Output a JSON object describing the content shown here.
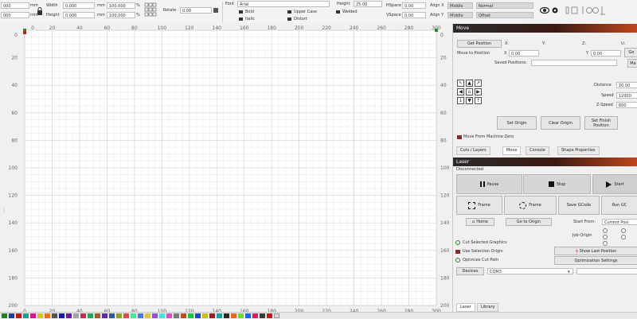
{
  "toolbar": {
    "x_value": "000",
    "y_value": "000",
    "width_label": "Width",
    "width_value": "0.000",
    "height_label": "Height",
    "height_value": "0.000",
    "unit_mm": "mm",
    "scale_w": "100.000",
    "scale_h": "100.000",
    "pct": "%",
    "rotate_label": "Rotate",
    "rotate_value": "0.00",
    "font_label": "Font",
    "font_value": "Arial",
    "font_height_label": "Height",
    "font_height_value": "25.00",
    "bold": "Bold",
    "italic": "Italic",
    "upper_case": "Upper Case",
    "distort": "Distort",
    "welded": "Welded",
    "hspace_label": "HSpace",
    "hspace_value": "0.00",
    "vspace_label": "VSpace",
    "vspace_value": "0.00",
    "align_x_label": "Align X",
    "align_x_value": "Middle",
    "align_y_label": "Align Y",
    "align_y_value": "Middle",
    "normal_value": "Normal",
    "offset_value": "Offset"
  },
  "ruler": {
    "top_ticks": [
      "0",
      "20",
      "40",
      "60",
      "80",
      "100",
      "120",
      "140",
      "160",
      "180",
      "200",
      "220",
      "240",
      "260",
      "280",
      "300"
    ],
    "left_ticks": [
      "0",
      "20",
      "40",
      "60",
      "80",
      "100",
      "120",
      "140",
      "160",
      "180",
      "200"
    ],
    "right_ticks": [
      "0",
      "20",
      "40",
      "60",
      "80",
      "100",
      "120",
      "140",
      "160",
      "180",
      "200"
    ],
    "bottom_ticks": [
      "0",
      "20",
      "40",
      "60",
      "80",
      "100",
      "120",
      "140",
      "160",
      "180",
      "200",
      "220",
      "240",
      "260",
      "280",
      "300"
    ]
  },
  "move": {
    "header": "Move",
    "get_position": "Get Position",
    "x_label": "X:",
    "y_label": "Y:",
    "z_label": "Z:",
    "u_label": "U:",
    "move_to_position": "Move to Position",
    "x_short": "X",
    "x_value": "0.00",
    "y_short": "Y",
    "y_value": "0.00",
    "go_label": "Go",
    "saved_positions": "Saved Positions:",
    "manage_label": "Ma",
    "distance_label": "Distance",
    "distance_value": "20.00",
    "speed_label": "Speed",
    "speed_value": "12000",
    "zspeed_label": "Z-Speed",
    "zspeed_value": "600",
    "set_origin": "Set Origin",
    "clear_origin": "Clear Origin",
    "set_finish": "Set Finish Position",
    "move_from_zero": "Move From Machine Zero"
  },
  "tabs_mid": [
    "Cuts / Layers",
    "Move",
    "Console",
    "Shape Properties"
  ],
  "laser": {
    "header": "Laser",
    "status": "Disconnected",
    "pause": "Pause",
    "stop": "Stop",
    "start": "Start",
    "frame1": "Frame",
    "frame2": "Frame",
    "save_gcode": "Save GCode",
    "run_gcode": "Run GC",
    "home": "Home",
    "go_to_origin": "Go to Origin",
    "start_from": "Start From:",
    "current_position": "Current Posi",
    "job_origin": "Job Origin",
    "cut_selected": "Cut Selected Graphics",
    "use_selection_origin": "Use Selection Origin",
    "optimize_cut": "Optimize Cut Path",
    "show_last_position": "Show Last Position",
    "optimization_settings": "Optimization Settings",
    "devices": "Devices",
    "com_value": "COM3"
  },
  "tabs_bottom": [
    "Laser",
    "Library"
  ],
  "colors": {
    "accent": "#c0451a",
    "grid": "#e4e4e4"
  }
}
